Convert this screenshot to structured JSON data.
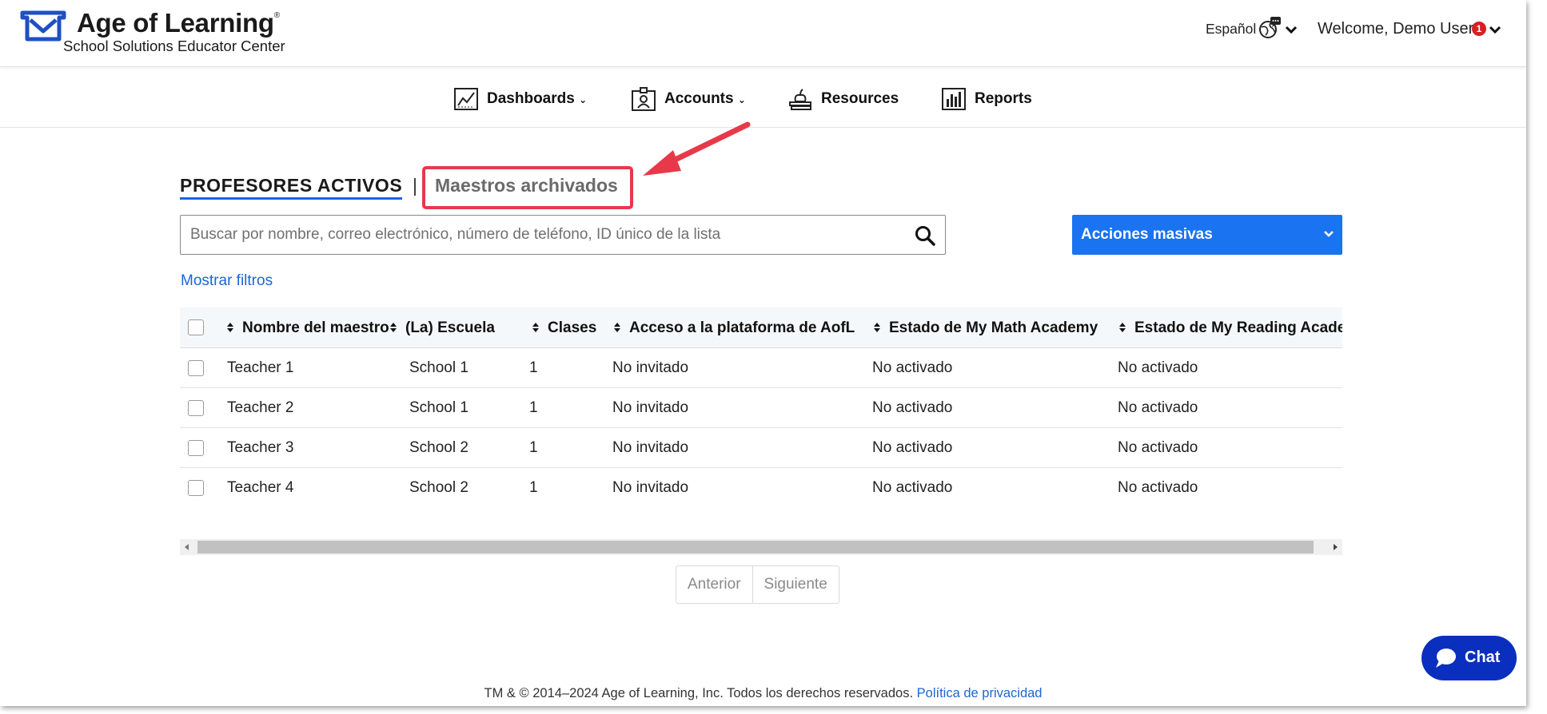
{
  "header": {
    "brand_title": "Age of Learning",
    "brand_mark": "®",
    "brand_subtitle": "School Solutions Educator Center",
    "language_label": "Español",
    "welcome_text": "Welcome, Demo User",
    "notification_count": "1"
  },
  "nav": {
    "items": [
      {
        "label": "Dashboards",
        "icon": "chart-line-icon",
        "has_dropdown": true
      },
      {
        "label": "Accounts",
        "icon": "id-card-icon",
        "has_dropdown": true
      },
      {
        "label": "Resources",
        "icon": "books-apple-icon",
        "has_dropdown": false
      },
      {
        "label": "Reports",
        "icon": "bar-chart-icon",
        "has_dropdown": false
      }
    ]
  },
  "tabs": {
    "active": "PROFESORES ACTIVOS",
    "separator": "|",
    "archived": "Maestros archivados"
  },
  "search": {
    "placeholder": "Buscar por nombre, correo electrónico, número de teléfono, ID único de la lista",
    "value": ""
  },
  "bulk_actions": {
    "label": "Acciones masivas"
  },
  "filters": {
    "label": "Mostrar filtros"
  },
  "table": {
    "columns": [
      "Nombre del maestro",
      "(La) Escuela",
      "Clases",
      "Acceso a la plataforma de AofL",
      "Estado de My Math Academy",
      "Estado de My Reading Academy"
    ],
    "rows": [
      [
        "Teacher 1",
        "School 1",
        "1",
        "No invitado",
        "No activado",
        "No activado"
      ],
      [
        "Teacher 2",
        "School 1",
        "1",
        "No invitado",
        "No activado",
        "No activado"
      ],
      [
        "Teacher 3",
        "School 2",
        "1",
        "No invitado",
        "No activado",
        "No activado"
      ],
      [
        "Teacher 4",
        "School 2",
        "1",
        "No invitado",
        "No activado",
        "No activado"
      ]
    ]
  },
  "pagination": {
    "prev": "Anterior",
    "next": "Siguiente"
  },
  "chat": {
    "label": "Chat"
  },
  "footer": {
    "copyright": "TM & © 2014–2024 Age of Learning, Inc. Todos los derechos reservados.",
    "privacy": "Política de privacidad"
  },
  "colors": {
    "primary": "#1a73f0",
    "link": "#1a66d6",
    "tab_underline": "#1565e8",
    "annotation": "#e8394a",
    "chat": "#0a2fbe",
    "badge": "#d61f26",
    "logo": "#1f4fc4"
  }
}
